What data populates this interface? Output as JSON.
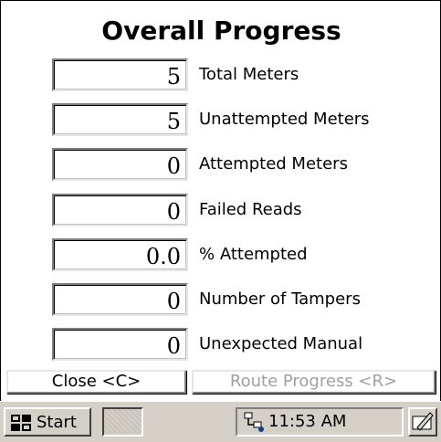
{
  "window": {
    "title": "Overall Progress"
  },
  "stats": [
    {
      "value": "5",
      "label": "Total Meters"
    },
    {
      "value": "5",
      "label": "Unattempted Meters"
    },
    {
      "value": "0",
      "label": "Attempted Meters"
    },
    {
      "value": "0",
      "label": "Failed Reads"
    },
    {
      "value": "0.0",
      "label": "% Attempted"
    },
    {
      "value": "0",
      "label": "Number of Tampers"
    },
    {
      "value": "0",
      "label": "Unexpected Manual"
    }
  ],
  "buttons": {
    "close_label": "Close <C>",
    "route_progress_label": "Route Progress <R>"
  },
  "taskbar": {
    "start_label": "Start",
    "start_icon": "windows-flag-icon",
    "tray_icon": "network-connection-icon",
    "clock": "11:53 AM",
    "sip_icon": "keyboard-pen-icon"
  },
  "colors": {
    "taskbar_bg": "#d4d0c8",
    "disabled_text": "#a0a0a0"
  }
}
